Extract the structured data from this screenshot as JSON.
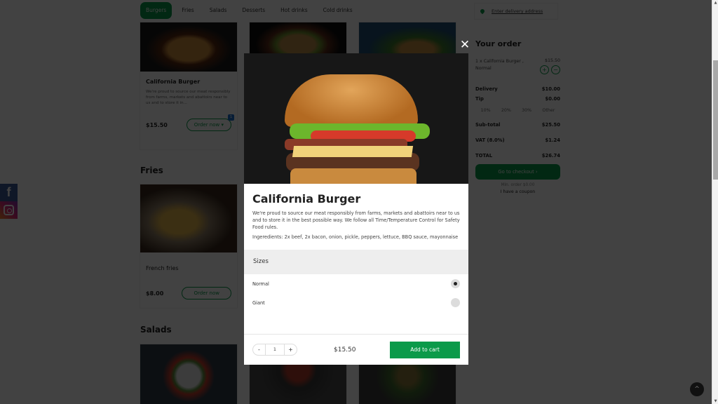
{
  "categories": [
    {
      "label": "Burgers",
      "active": true
    },
    {
      "label": "Fries",
      "active": false
    },
    {
      "label": "Salads",
      "active": false
    },
    {
      "label": "Desserts",
      "active": false
    },
    {
      "label": "Hot drinks",
      "active": false
    },
    {
      "label": "Cold drinks",
      "active": false
    }
  ],
  "sections": {
    "fries": "Fries",
    "salads": "Salads"
  },
  "menu": {
    "burger_card": {
      "name": "California Burger",
      "description": "We're proud to source our meat responsibly from farms, markets and abattoirs near to us and to store it in...",
      "price": "$15.50",
      "order_label": "Order now ▾",
      "badge": "1"
    },
    "fries_card": {
      "name": "French fries",
      "price": "$8.00",
      "order_label": "Order now"
    }
  },
  "delivery": {
    "address_link": "Enter delivery address"
  },
  "order": {
    "title": "Your order",
    "items": [
      {
        "label": "1 x California Burger , Normal",
        "price": "$15.50",
        "plus": "+",
        "minus": "−"
      }
    ],
    "delivery_label": "Delivery",
    "delivery_value": "$10.00",
    "tip_label": "Tip",
    "tip_value": "$0.00",
    "tip_options": [
      "10%",
      "20%",
      "30%",
      "Other"
    ],
    "subtotal_label": "Sub-total",
    "subtotal_value": "$25.50",
    "vat_label": "VAT (8.0%)",
    "vat_value": "$1.24",
    "total_label": "TOTAL",
    "total_value": "$26.74",
    "checkout_label": "Go to checkout ›",
    "min_order": "Min. order $0.00",
    "coupon_link": "I have a coupon"
  },
  "modal": {
    "close": "✕",
    "title": "California Burger",
    "description": "We're proud to source our meat responsibly from farms, markets and abattoirs near to us and to store it in the best possible way. We follow all Time/Temperature Control for Safety Food rules.",
    "ingredients": "Ingeredients: 2x beef, 2x bacon, onion, pickle, peppers, lettuce, BBQ sauce, mayonnaise",
    "sizes_heading": "Sizes",
    "sizes": [
      {
        "label": "Normal",
        "selected": true
      },
      {
        "label": "Giant",
        "selected": false
      }
    ],
    "quantity": "1",
    "minus": "-",
    "plus": "+",
    "price": "$15.50",
    "add_label": "Add to cart"
  },
  "social": {
    "facebook": "f"
  },
  "scroll_top": "^",
  "scrollbar": {
    "up": "▲",
    "down": "▼"
  },
  "colors": {
    "accent": "#0b9a4a",
    "overlay": "rgba(0,0,0,0.74)"
  }
}
